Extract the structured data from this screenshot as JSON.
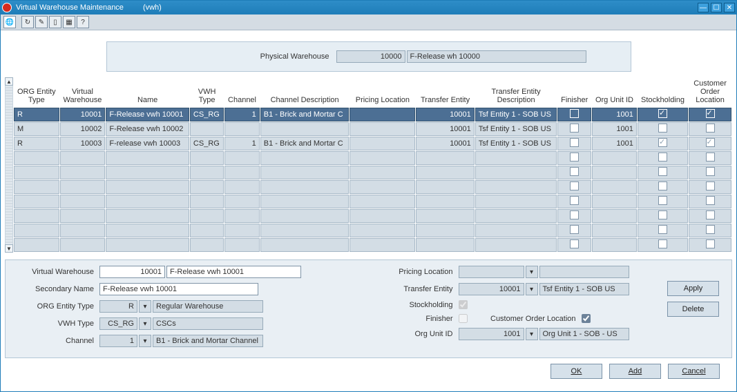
{
  "window": {
    "title": "Virtual Warehouse Maintenance",
    "subtitle": "(vwh)"
  },
  "toolbar": {
    "icons": [
      "globe",
      "refresh",
      "note",
      "layout",
      "grid",
      "help",
      "query"
    ]
  },
  "physical": {
    "label": "Physical Warehouse",
    "id": "10000",
    "desc": "F-Release wh 10000"
  },
  "columns": {
    "org_entity_type": "ORG Entity\nType",
    "virtual_warehouse": "Virtual\nWarehouse",
    "name": "Name",
    "vwh_type": "VWH\nType",
    "channel": "Channel",
    "channel_desc": "Channel Description",
    "pricing_loc": "Pricing Location",
    "transfer_entity": "Transfer Entity",
    "transfer_entity_desc": "Transfer Entity\nDescription",
    "finisher": "Finisher",
    "org_unit_id": "Org Unit ID",
    "stockholding": "Stockholding",
    "cust_order_loc": "Customer\nOrder\nLocation"
  },
  "rows": [
    {
      "org": "R",
      "vw": "10001",
      "name": "F-Release vwh 10001",
      "vwh": "CS_RG",
      "ch": "1",
      "chdesc": "B1 - Brick and Mortar C",
      "ploc": "",
      "te": "10001",
      "tedesc": "Tsf Entity 1 - SOB US",
      "fin": false,
      "ouid": "1001",
      "stock": true,
      "col": true,
      "sel": true
    },
    {
      "org": "M",
      "vw": "10002",
      "name": "F-Release vwh 10002",
      "vwh": "",
      "ch": "",
      "chdesc": "",
      "ploc": "",
      "te": "10001",
      "tedesc": "Tsf Entity 1 - SOB US",
      "fin": false,
      "ouid": "1001",
      "stock": false,
      "col": false,
      "sel": false
    },
    {
      "org": "R",
      "vw": "10003",
      "name": "F-release vwh 10003",
      "vwh": "CS_RG",
      "ch": "1",
      "chdesc": "B1 - Brick and Mortar C",
      "ploc": "",
      "te": "10001",
      "tedesc": "Tsf Entity 1 - SOB US",
      "fin": false,
      "ouid": "1001",
      "stock": true,
      "col": true,
      "sel": false
    }
  ],
  "form": {
    "l": {
      "virtual_warehouse_label": "Virtual Warehouse",
      "virtual_warehouse_id": "10001",
      "virtual_warehouse_name": "F-Release vwh 10001",
      "secondary_name_label": "Secondary Name",
      "secondary_name": "F-Release vwh 10001",
      "org_entity_label": "ORG Entity Type",
      "org_entity_code": "R",
      "org_entity_desc": "Regular Warehouse",
      "vwh_type_label": "VWH Type",
      "vwh_type_code": "CS_RG",
      "vwh_type_desc": "CSCs",
      "channel_label": "Channel",
      "channel_id": "1",
      "channel_desc": "B1 - Brick and Mortar Channel"
    },
    "r": {
      "pricing_loc_label": "Pricing Location",
      "pricing_loc": "",
      "pricing_loc_desc": "",
      "transfer_entity_label": "Transfer Entity",
      "transfer_entity_id": "10001",
      "transfer_entity_desc": "Tsf Entity 1 - SOB US",
      "stockholding_label": "Stockholding",
      "finisher_label": "Finisher",
      "col_label": "Customer Order Location",
      "org_unit_label": "Org Unit ID",
      "org_unit_id": "1001",
      "org_unit_desc": "Org Unit 1 - SOB - US"
    }
  },
  "buttons": {
    "apply": "Apply",
    "delete": "Delete",
    "ok": "OK",
    "ok_u": "O",
    "add": "Add",
    "add_u": "A",
    "cancel": "Cancel",
    "cancel_u": "C"
  }
}
